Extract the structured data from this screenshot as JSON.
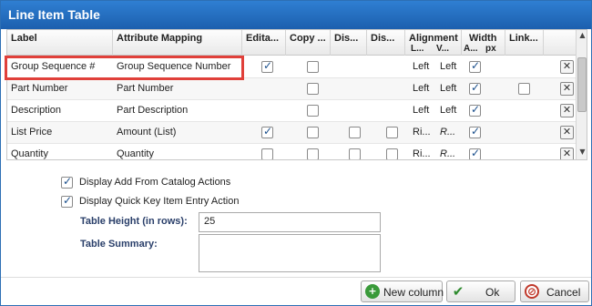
{
  "dialog": {
    "title": "Line Item Table"
  },
  "grid": {
    "headers": {
      "label": "Label",
      "attribute_mapping": "Attribute Mapping",
      "editable": "Edita...",
      "copy": "Copy ...",
      "dis1": "Dis...",
      "dis2": "Dis...",
      "alignment": "Alignment",
      "alignment_sub_l": "L...",
      "alignment_sub_v": "V...",
      "width": "Width",
      "width_sub_a": "A...",
      "width_sub_px": "px",
      "link": "Link..."
    },
    "rows": [
      {
        "label": "Group Sequence #",
        "mapping": "Group Sequence Number",
        "editable": true,
        "copy": false,
        "dis1": null,
        "dis2": null,
        "align_l": "Left",
        "align_v": "Left",
        "v_italic": false,
        "auto": true,
        "link": null
      },
      {
        "label": "Part Number",
        "mapping": "Part Number",
        "editable": null,
        "copy": false,
        "dis1": null,
        "dis2": null,
        "align_l": "Left",
        "align_v": "Left",
        "v_italic": false,
        "auto": true,
        "link": false
      },
      {
        "label": "Description",
        "mapping": "Part Description",
        "editable": null,
        "copy": false,
        "dis1": null,
        "dis2": null,
        "align_l": "Left",
        "align_v": "Left",
        "v_italic": false,
        "auto": true,
        "link": null
      },
      {
        "label": "List Price",
        "mapping": "Amount (List)",
        "editable": true,
        "copy": false,
        "dis1": false,
        "dis2": false,
        "align_l": "Ri...",
        "align_v": "R...",
        "v_italic": true,
        "auto": true,
        "link": null
      },
      {
        "label": "Quantity",
        "mapping": "Quantity",
        "editable": false,
        "copy": false,
        "dis1": false,
        "dis2": false,
        "align_l": "Ri...",
        "align_v": "R...",
        "v_italic": true,
        "auto": true,
        "link": null
      }
    ],
    "remove_icon": "close-icon"
  },
  "options": {
    "add_from_catalog": {
      "label": "Display Add From Catalog Actions",
      "checked": true
    },
    "quick_key": {
      "label": "Display Quick Key Item Entry Action",
      "checked": true
    },
    "table_height_label": "Table Height (in rows):",
    "table_height_value": "25",
    "table_summary_label": "Table Summary:",
    "table_summary_value": ""
  },
  "footer": {
    "new_column": "New column",
    "ok": "Ok",
    "cancel": "Cancel"
  },
  "colors": {
    "title_bar": "#1c5fae",
    "highlight": "#e0403a",
    "plus_green": "#3a9a3a",
    "ok_green": "#2e8b2e",
    "cancel_red": "#c0392b"
  }
}
